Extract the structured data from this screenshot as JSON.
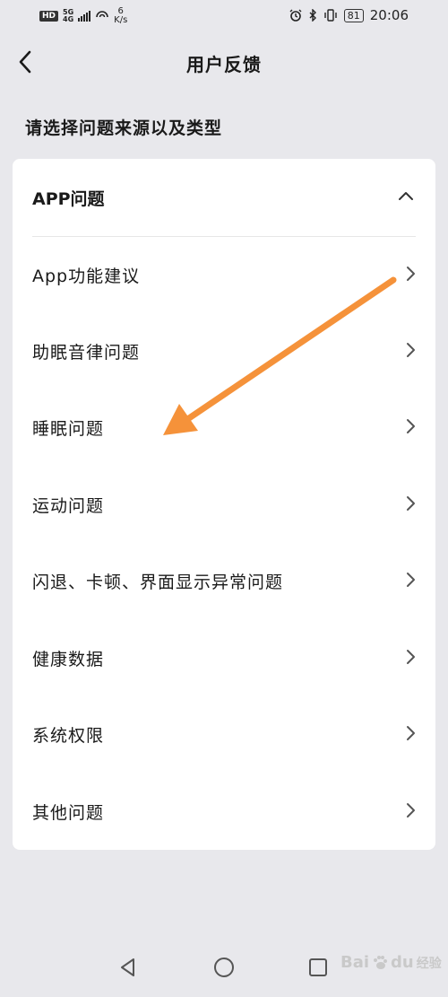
{
  "status_bar": {
    "network_badge": "HD",
    "network_type": "5G",
    "network_sub": "4G",
    "speed_value": "6",
    "speed_unit": "K/s",
    "battery": "81",
    "time": "20:06"
  },
  "header": {
    "title": "用户反馈"
  },
  "section": {
    "title": "请选择问题来源以及类型"
  },
  "card": {
    "header_label": "APP问题",
    "items": [
      {
        "label": "App功能建议"
      },
      {
        "label": "助眠音律问题"
      },
      {
        "label": "睡眠问题"
      },
      {
        "label": "运动问题"
      },
      {
        "label": "闪退、卡顿、界面显示异常问题"
      },
      {
        "label": "健康数据"
      },
      {
        "label": "系统权限"
      },
      {
        "label": "其他问题"
      }
    ]
  },
  "watermark": {
    "brand": "Bai",
    "brand2": "du",
    "sub": "经验"
  },
  "colors": {
    "background": "#e8e8ec",
    "card": "#ffffff",
    "arrow": "#f5923a"
  },
  "icons": [
    "back-icon",
    "chevron-up-icon",
    "chevron-right-icon",
    "nav-back-icon",
    "nav-home-icon",
    "nav-recents-icon",
    "alarm-icon",
    "bluetooth-icon",
    "vibrate-icon",
    "battery-icon",
    "wifi-icon",
    "signal-icon"
  ]
}
